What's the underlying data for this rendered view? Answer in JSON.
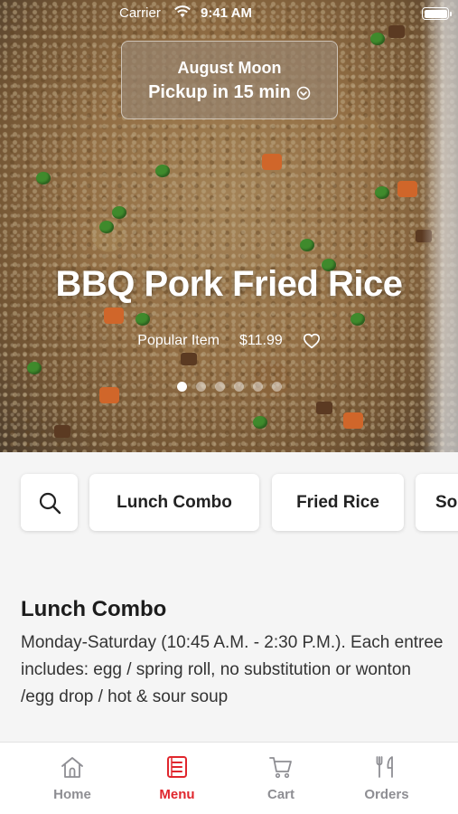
{
  "status_bar": {
    "carrier": "Carrier",
    "time": "9:41 AM"
  },
  "pickup": {
    "restaurant": "August Moon",
    "pickup_text": "Pickup in 15 min"
  },
  "hero": {
    "title": "BBQ Pork Fried Rice",
    "tag": "Popular Item",
    "price": "$11.99",
    "carousel_total": 6,
    "carousel_active": 1
  },
  "categories": {
    "search_icon": "search-icon",
    "items": [
      "Lunch Combo",
      "Fried Rice",
      "So"
    ]
  },
  "section": {
    "title": "Lunch Combo",
    "description": "Monday-Saturday (10:45 A.M. - 2:30 P.M.). Each entree includes: egg / spring roll, no substitution or wonton /egg drop / hot & sour soup"
  },
  "tabs": [
    {
      "label": "Home",
      "icon": "home-icon"
    },
    {
      "label": "Menu",
      "icon": "menu-icon"
    },
    {
      "label": "Cart",
      "icon": "cart-icon"
    },
    {
      "label": "Orders",
      "icon": "orders-icon"
    }
  ],
  "colors": {
    "accent": "#e0262d",
    "inactive_tab": "#8e8e93"
  }
}
